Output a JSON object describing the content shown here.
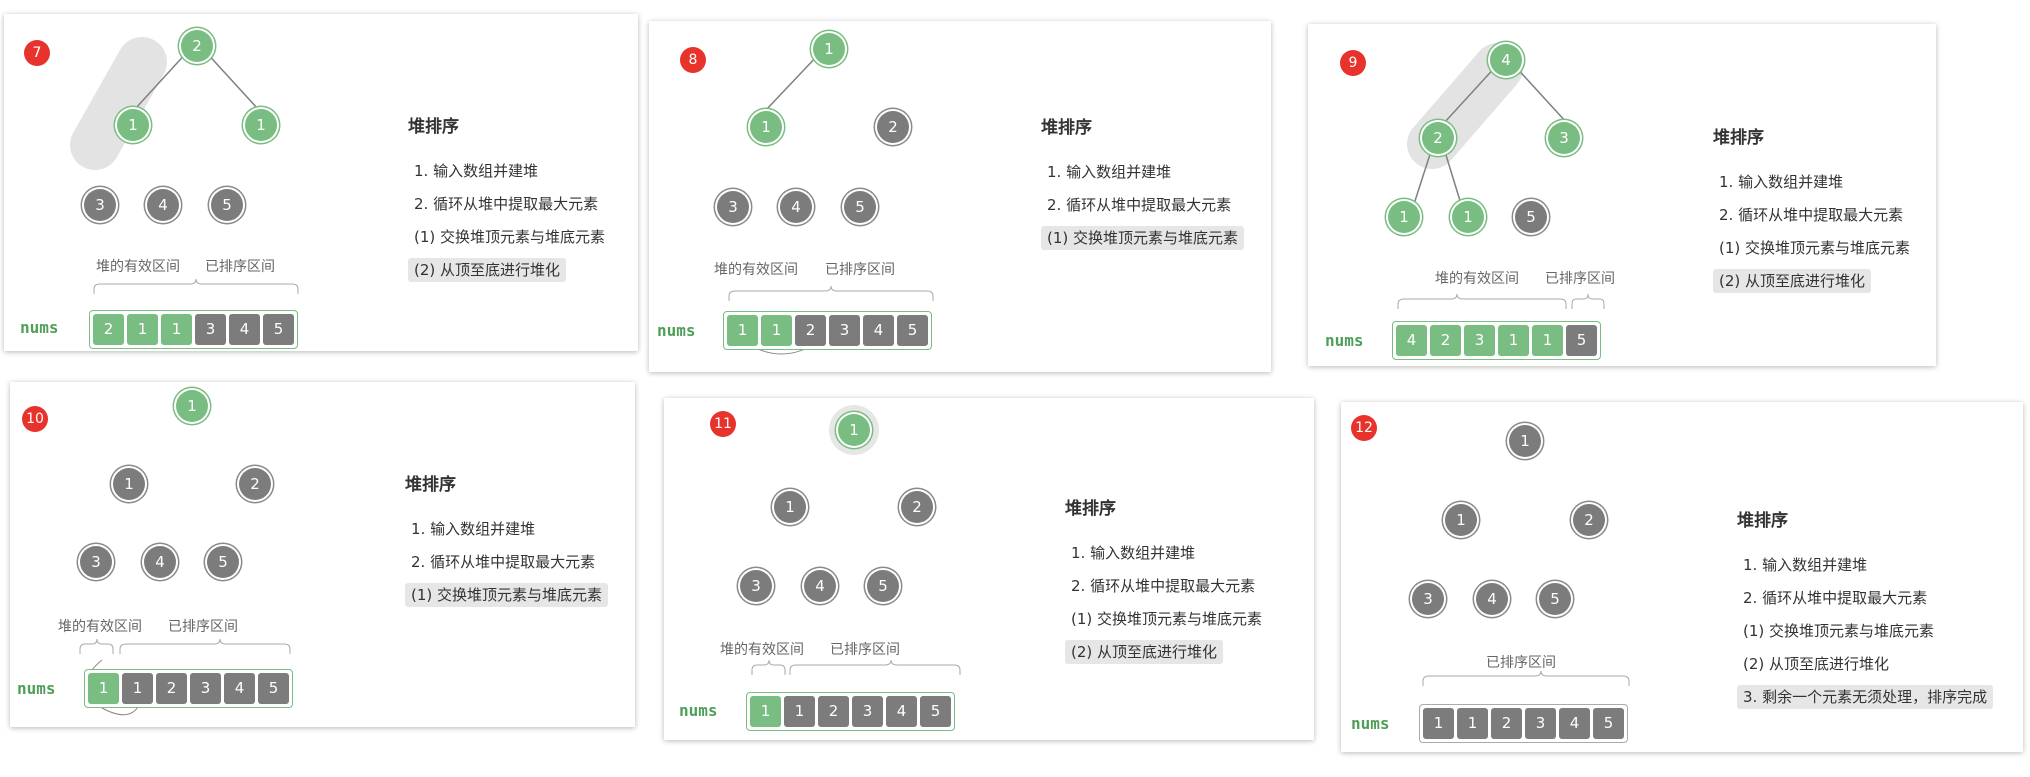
{
  "colors": {
    "green": "#79bd82",
    "gray": "#7c7c7c",
    "badge": "#e8332c"
  },
  "common": {
    "title": "堆排序",
    "step1": "1. 输入数组并建堆",
    "step2": "2. 循环从堆中提取最大元素",
    "step2a": "(1) 交换堆顶元素与堆底元素",
    "step2b": "(2) 从顶至底进行堆化",
    "step3": "3. 剩余一个元素无须处理，排序完成",
    "heap_label": "堆的有效区间",
    "sorted_label": "已排序区间",
    "nums_label": "nums"
  },
  "panels": [
    {
      "badge": "7",
      "tree": [
        "2",
        "1",
        "1",
        "3",
        "4",
        "5"
      ],
      "array": [
        "2",
        "1",
        "1",
        "3",
        "4",
        "5"
      ]
    },
    {
      "badge": "8",
      "tree": [
        "1",
        "1",
        "2",
        "3",
        "4",
        "5"
      ],
      "array": [
        "1",
        "1",
        "2",
        "3",
        "4",
        "5"
      ]
    },
    {
      "badge": "9",
      "tree": [
        "4",
        "2",
        "3",
        "1",
        "1",
        "5"
      ],
      "array": [
        "4",
        "2",
        "3",
        "1",
        "1",
        "5"
      ]
    },
    {
      "badge": "10",
      "tree": [
        "1",
        "1",
        "2",
        "3",
        "4",
        "5"
      ],
      "array": [
        "1",
        "1",
        "2",
        "3",
        "4",
        "5"
      ]
    },
    {
      "badge": "11",
      "tree": [
        "1",
        "1",
        "2",
        "3",
        "4",
        "5"
      ],
      "array": [
        "1",
        "1",
        "2",
        "3",
        "4",
        "5"
      ]
    },
    {
      "badge": "12",
      "tree": [
        "1",
        "1",
        "2",
        "3",
        "4",
        "5"
      ],
      "array": [
        "1",
        "1",
        "2",
        "3",
        "4",
        "5"
      ]
    }
  ]
}
